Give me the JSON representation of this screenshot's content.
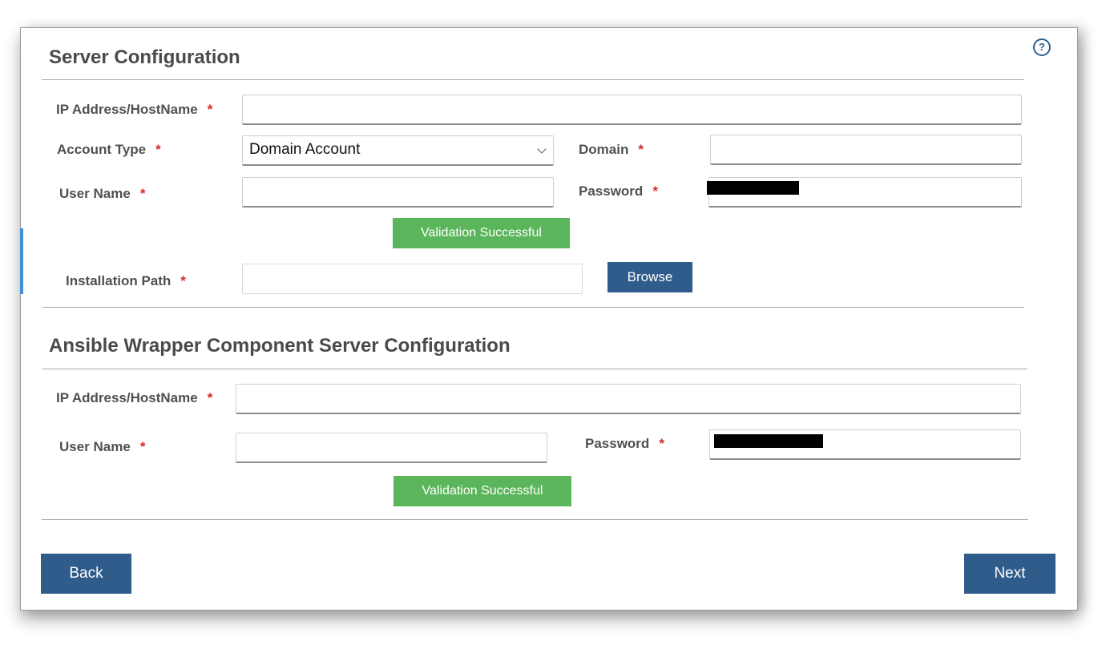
{
  "help": {
    "icon": "question-circle-icon",
    "glyph": "?"
  },
  "server_config": {
    "title": "Server Configuration",
    "ip_label": "IP Address/HostName",
    "ip_value": "",
    "account_type_label": "Account Type",
    "account_type_value": "Domain Account",
    "domain_label": "Domain",
    "domain_value": "",
    "username_label": "User Name",
    "username_value": "",
    "password_label": "Password",
    "validation_label": "Validation Successful",
    "install_path_label": "Installation Path",
    "install_path_value": "",
    "browse_label": "Browse"
  },
  "ansible_config": {
    "title": "Ansible Wrapper Component Server Configuration",
    "ip_label": "IP Address/HostName",
    "ip_value": "",
    "username_label": "User Name",
    "username_value": "",
    "password_label": "Password",
    "validation_label": "Validation Successful"
  },
  "required_marker": "*",
  "footer": {
    "back_label": "Back",
    "next_label": "Next"
  },
  "colors": {
    "accent_blue": "#2f5c8a",
    "success_green": "#5bb55b",
    "required_red": "#d22a2a"
  }
}
